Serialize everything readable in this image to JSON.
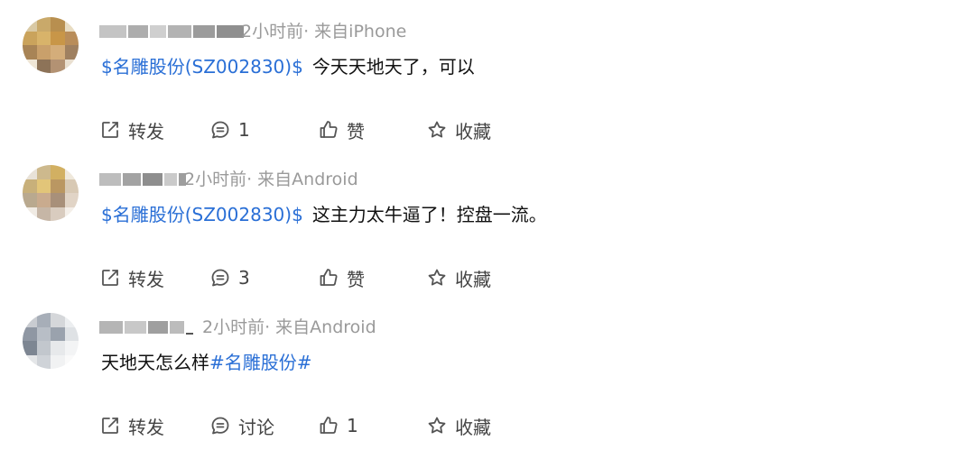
{
  "posts": [
    {
      "meta": "2小时前· 来自iPhone",
      "stock": "$名雕股份(SZ002830)$",
      "text": "今天天地天了，可以",
      "tag": "",
      "actions": {
        "repost": "转发",
        "comment": "1",
        "like": "赞",
        "favorite": "收藏"
      }
    },
    {
      "meta": "2小时前· 来自Android",
      "stock": "$名雕股份(SZ002830)$",
      "text": "这主力太牛逼了！控盘一流。",
      "tag": "",
      "actions": {
        "repost": "转发",
        "comment": "3",
        "like": "赞",
        "favorite": "收藏"
      }
    },
    {
      "meta": "2小时前· 来自Android",
      "stock": "",
      "text": "天地天怎么样",
      "tag": "#名雕股份#",
      "actions": {
        "repost": "转发",
        "comment": "讨论",
        "like": "1",
        "favorite": "收藏"
      }
    }
  ],
  "colors": {
    "link": "#2a6fd6",
    "meta": "#9a9a9a",
    "action": "#444444"
  },
  "icons": {
    "repost": "share-icon",
    "comment": "comment-icon",
    "like": "thumbs-up-icon",
    "favorite": "star-icon"
  }
}
